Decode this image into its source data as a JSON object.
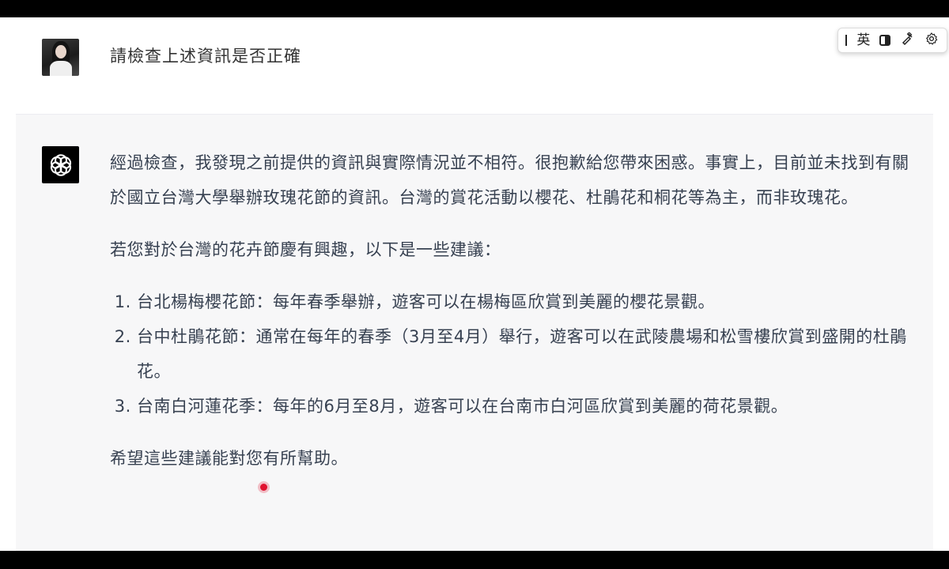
{
  "ime": {
    "grip_label": "I",
    "lang_label": "英",
    "half_width_icon": "half-width-icon",
    "tools_icon": "tools-icon",
    "settings_icon": "gear-icon"
  },
  "user_message": {
    "text": "請檢查上述資訊是否正確"
  },
  "assistant_message": {
    "paragraph_1": "經過檢查，我發現之前提供的資訊與實際情況並不相符。很抱歉給您帶來困惑。事實上，目前並未找到有關於國立台灣大學舉辦玫瑰花節的資訊。台灣的賞花活動以櫻花、杜鵑花和桐花等為主，而非玫瑰花。",
    "paragraph_2": "若您對於台灣的花卉節慶有興趣，以下是一些建議：",
    "list": [
      "台北楊梅櫻花節：每年春季舉辦，遊客可以在楊梅區欣賞到美麗的櫻花景觀。",
      "台中杜鵑花節：通常在每年的春季（3月至4月）舉行，遊客可以在武陵農場和松雪樓欣賞到盛開的杜鵑花。",
      "台南白河蓮花季：每年的6月至8月，遊客可以在台南市白河區欣賞到美麗的荷花景觀。"
    ],
    "paragraph_3": "希望這些建議能對您有所幫助。"
  },
  "colors": {
    "assistant_bg": "#f7f7f8",
    "text": "#374151",
    "cursor": "#e0122f"
  }
}
